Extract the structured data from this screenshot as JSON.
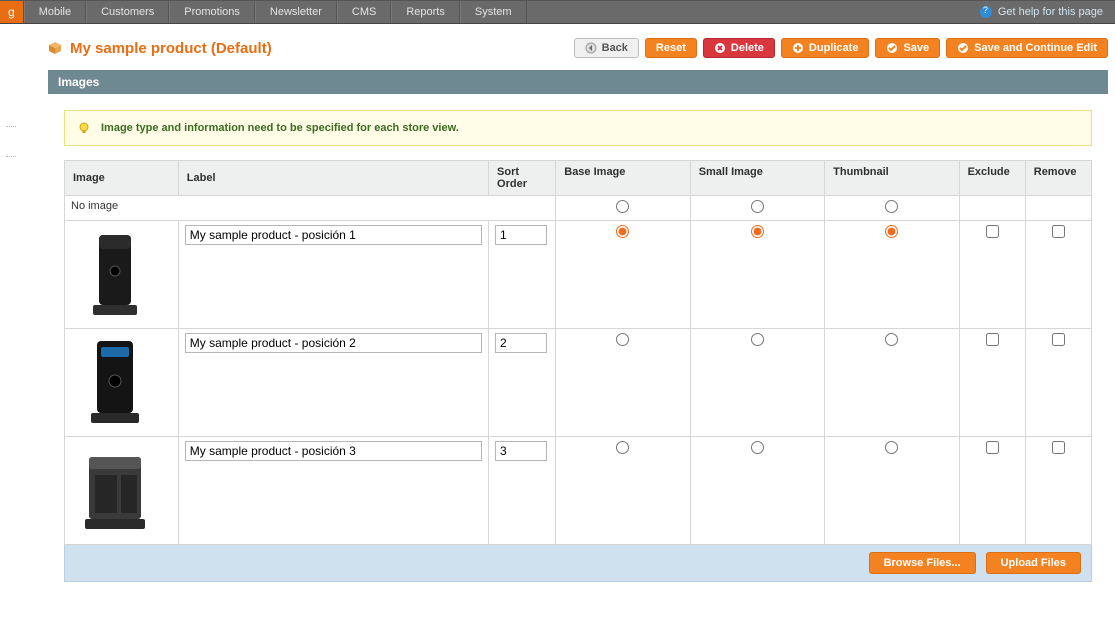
{
  "nav": {
    "active_fragment": "g",
    "items": [
      "Mobile",
      "Customers",
      "Promotions",
      "Newsletter",
      "CMS",
      "Reports",
      "System"
    ],
    "help_label": "Get help for this page"
  },
  "title": "My sample product (Default)",
  "toolbar": {
    "back": "Back",
    "reset": "Reset",
    "delete": "Delete",
    "duplicate": "Duplicate",
    "save": "Save",
    "save_continue": "Save and Continue Edit"
  },
  "section_title": "Images",
  "notice": "Image type and information need to be specified for each store view.",
  "headers": {
    "image": "Image",
    "label": "Label",
    "sort": "Sort Order",
    "base": "Base Image",
    "small": "Small Image",
    "thumb": "Thumbnail",
    "exclude": "Exclude",
    "remove": "Remove"
  },
  "no_image_label": "No image",
  "rows": [
    {
      "label": "My sample product - posición 1",
      "sort": "1",
      "base": true,
      "small": true,
      "thumb": true,
      "exclude": false,
      "remove": false
    },
    {
      "label": "My sample product - posición 2",
      "sort": "2",
      "base": false,
      "small": false,
      "thumb": false,
      "exclude": false,
      "remove": false
    },
    {
      "label": "My sample product - posición 3",
      "sort": "3",
      "base": false,
      "small": false,
      "thumb": false,
      "exclude": false,
      "remove": false
    }
  ],
  "upload": {
    "browse": "Browse Files...",
    "upload": "Upload Files"
  }
}
